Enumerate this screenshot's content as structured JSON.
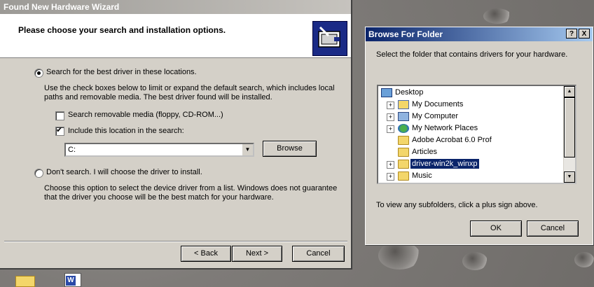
{
  "wizard": {
    "title": "Found New Hardware Wizard",
    "heading": "Please choose your search and installation options.",
    "option_search": {
      "label": "Search for the best driver in these locations.",
      "selected": true,
      "description": "Use the check boxes below to limit or expand the default search, which includes local paths and removable media. The best driver found will be installed."
    },
    "check_removable": {
      "label": "Search removable media (floppy, CD-ROM...)",
      "checked": false
    },
    "check_location": {
      "label": "Include this location in the search:",
      "checked": true
    },
    "location_value": "C:",
    "browse_label": "Browse",
    "option_dont_search": {
      "label": "Don't search. I will choose the driver to install.",
      "selected": false,
      "description": "Choose this option to select the device driver from a list.  Windows does not guarantee that the driver you choose will be the best match for your hardware."
    },
    "back_label": "< Back",
    "next_label": "Next >",
    "cancel_label": "Cancel"
  },
  "browse": {
    "title": "Browse For Folder",
    "help_label": "?",
    "close_label": "X",
    "instruction": "Select the folder that contains drivers for your hardware.",
    "tree": [
      {
        "label": "Desktop",
        "icon": "desktop-icon",
        "expander": ""
      },
      {
        "label": "My Documents",
        "icon": "my-documents-icon",
        "expander": "+"
      },
      {
        "label": "My Computer",
        "icon": "my-computer-icon",
        "expander": "+"
      },
      {
        "label": "My Network Places",
        "icon": "network-places-icon",
        "expander": "+"
      },
      {
        "label": "Adobe Acrobat 6.0 Prof",
        "icon": "folder-icon",
        "expander": ""
      },
      {
        "label": "Articles",
        "icon": "folder-icon",
        "expander": ""
      },
      {
        "label": "driver-win2k_winxp",
        "icon": "folder-icon",
        "expander": "+",
        "selected": true
      },
      {
        "label": "Music",
        "icon": "folder-icon",
        "expander": "+"
      }
    ],
    "hint": "To view any subfolders, click a plus sign above.",
    "ok_label": "OK",
    "cancel_label": "Cancel"
  },
  "colors": {
    "dialog_face": "#d4d0c8",
    "active_title": "#0a246a",
    "inactive_title": "#9c9a96",
    "selection": "#0a246a"
  }
}
